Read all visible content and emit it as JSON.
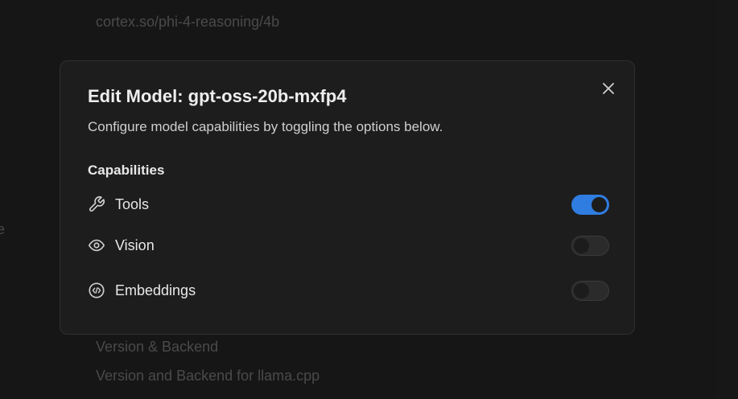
{
  "background": {
    "url_text": "cortex.so/phi-4-reasoning/4b",
    "edge_text": "e",
    "version_heading": "Version & Backend",
    "version_description": "Version and Backend for llama.cpp"
  },
  "dialog": {
    "title": "Edit Model: gpt-oss-20b-mxfp4",
    "subtitle": "Configure model capabilities by toggling the options below.",
    "close_icon": "close-icon",
    "section_heading": "Capabilities",
    "capabilities": [
      {
        "label": "Tools",
        "icon": "wrench-icon",
        "enabled": true
      },
      {
        "label": "Vision",
        "icon": "eye-icon",
        "enabled": false
      },
      {
        "label": "Embeddings",
        "icon": "code-circle-icon",
        "enabled": false
      }
    ]
  },
  "colors": {
    "page_background": "#181818",
    "dialog_background": "#1d1d1d",
    "toggle_on": "#2f7de0",
    "toggle_off": "#2b2b2b",
    "muted_text": "#4e4e4e"
  }
}
